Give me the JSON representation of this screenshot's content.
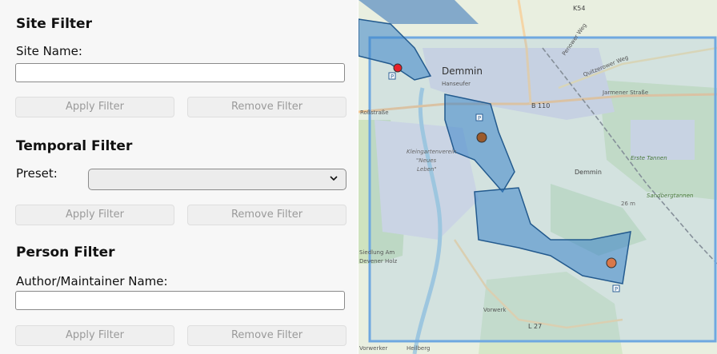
{
  "site_filter": {
    "title": "Site Filter",
    "name_label": "Site Name:",
    "name_value": "",
    "apply_label": "Apply Filter",
    "remove_label": "Remove Filter"
  },
  "temporal_filter": {
    "title": "Temporal Filter",
    "preset_label": "Preset:",
    "preset_value": "",
    "apply_label": "Apply Filter",
    "remove_label": "Remove Filter"
  },
  "person_filter": {
    "title": "Person Filter",
    "name_label": "Author/Maintainer Name:",
    "name_value": "",
    "apply_label": "Apply Filter",
    "remove_label": "Remove Filter"
  },
  "map": {
    "labels": {
      "k54": "K54",
      "demmin": "Demmin",
      "demmin_station": "Demmin",
      "hanseufer": "Hanseufer",
      "b110": "B 110",
      "jarmener": "Jarmener Straße",
      "quitzerower": "Quitzerower Weg",
      "penower": "Penower Weg",
      "rosstrasse": "Roßstraße",
      "kleingarten1": "Kleingartenverein",
      "kleingarten2": "\"Neues",
      "kleingarten3": "Leben\"",
      "erste_tannen": "Erste Tannen",
      "sandbergtannen": "Sandbergtannen",
      "elev": "26 m",
      "siedlung1": "Siedlung Am",
      "siedlung2": "Devener Holz",
      "vorwerk": "Vorwerk",
      "l27": "L 27",
      "vorwerker": "Vorwerker",
      "heilberg": "Heilberg",
      "parking": "P"
    },
    "colors": {
      "site_red": "#e8202a",
      "site_brown": "#9b5a2b",
      "site_orange": "#d9784a",
      "area_fill": "#3a84c8",
      "bbox_stroke": "#6fa8e0"
    }
  }
}
